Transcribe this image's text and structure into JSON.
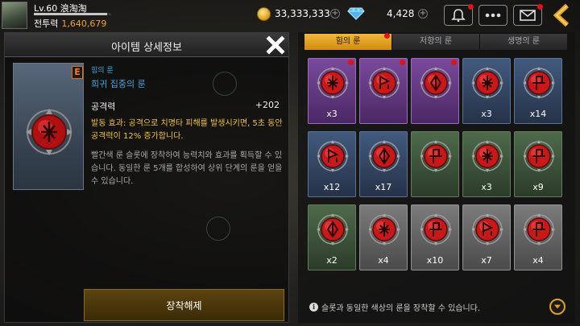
{
  "player": {
    "level_name": "Lv.60 浪淘淘",
    "power_label": "전투력",
    "power_value": "1,640,679",
    "exp_fraction": 0.95
  },
  "currency": {
    "gold": "33,333,333",
    "gems": "4,428"
  },
  "detail": {
    "title": "아이템 상세정보",
    "grade": "E",
    "rune_type": "힘의 룬",
    "rune_name": "희귀 집중의 룬",
    "stat_label": "공격력",
    "stat_value": "+202",
    "effect": "발동 효과: 공격으로 치명타 피해를 발생시키면, 5초 동안 공격력이 12% 증가합니다.",
    "description": "빨간색 룬 슬롯에 장착하여 능력치와 효과를 획득할 수 있습니다. 동일한 룬 5개를 합성하여 상위 단계의 룬을 얻을 수 있습니다.",
    "unequip_label": "장착해제"
  },
  "tabs": [
    {
      "label": "힘의 룬",
      "active": true,
      "alert": true
    },
    {
      "label": "저항의 룬",
      "active": false,
      "alert": false
    },
    {
      "label": "생명의 룬",
      "active": false,
      "alert": false
    }
  ],
  "runes": [
    {
      "grade": "purple",
      "count": "x3",
      "alert": true,
      "glyph": "cross"
    },
    {
      "grade": "purple",
      "count": "",
      "alert": true,
      "glyph": "arrow"
    },
    {
      "grade": "purple",
      "count": "",
      "alert": true,
      "glyph": "diamond"
    },
    {
      "grade": "blue",
      "count": "x3",
      "alert": false,
      "glyph": "cross"
    },
    {
      "grade": "blue",
      "count": "x14",
      "alert": false,
      "glyph": "p"
    },
    {
      "grade": "blue",
      "count": "x12",
      "alert": false,
      "glyph": "arrow"
    },
    {
      "grade": "blue",
      "count": "x17",
      "alert": false,
      "glyph": "diamond"
    },
    {
      "grade": "green",
      "count": "",
      "alert": false,
      "glyph": "p"
    },
    {
      "grade": "green",
      "count": "x3",
      "alert": false,
      "glyph": "cross"
    },
    {
      "grade": "green",
      "count": "x9",
      "alert": false,
      "glyph": "p"
    },
    {
      "grade": "green",
      "count": "x2",
      "alert": false,
      "glyph": "diamond"
    },
    {
      "grade": "gray",
      "count": "x4",
      "alert": false,
      "glyph": "cross"
    },
    {
      "grade": "gray",
      "count": "x10",
      "alert": false,
      "glyph": "p"
    },
    {
      "grade": "gray",
      "count": "x7",
      "alert": false,
      "glyph": "arrow"
    },
    {
      "grade": "gray",
      "count": "x4",
      "alert": false,
      "glyph": "p"
    }
  ],
  "footer": {
    "info": "슬롯과 동일한 색상의 룬을 장착할 수 있습니다."
  },
  "colors": {
    "accent_gold": "#e8a020",
    "rune_red": "#c81818",
    "info_blue": "#3fa8e0",
    "effect_yellow": "#f0c43a",
    "power_orange": "#f0a030"
  }
}
